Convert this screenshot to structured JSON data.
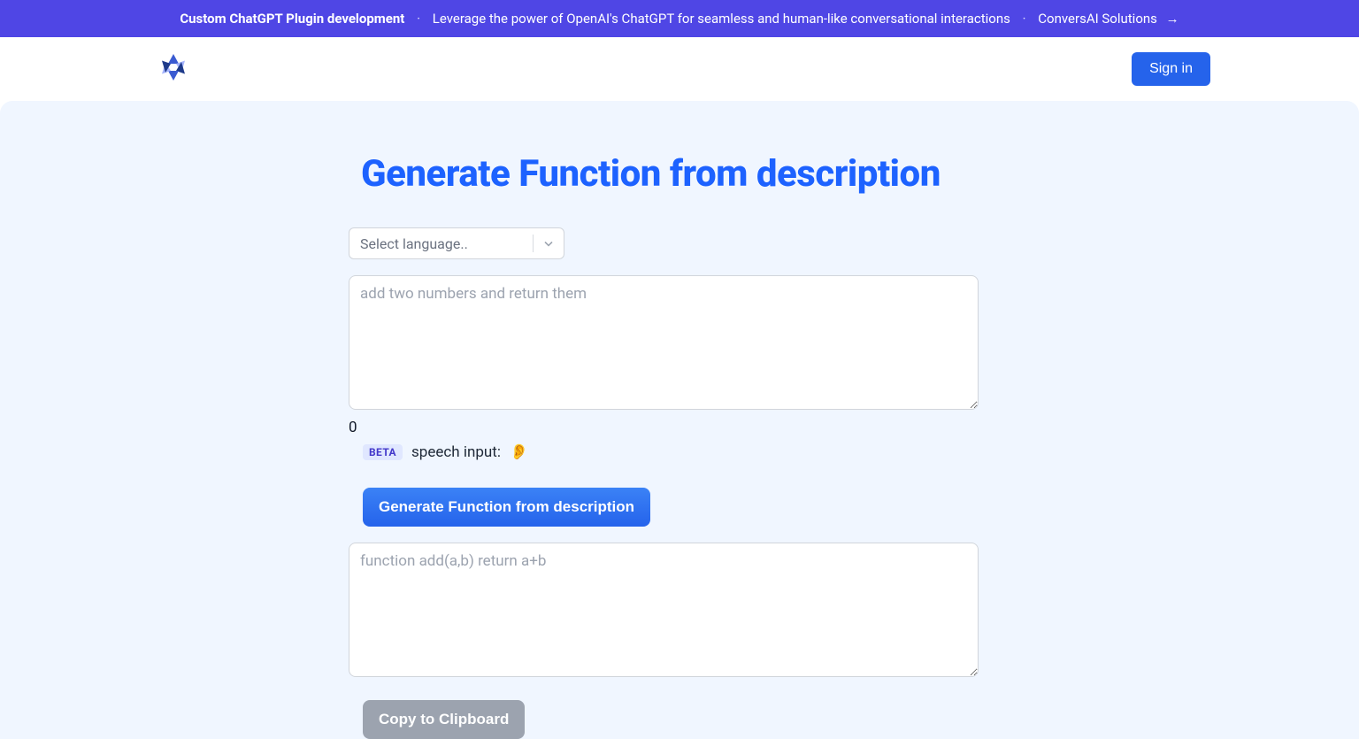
{
  "banner": {
    "headline": "Custom ChatGPT Plugin development",
    "subline": "Leverage the power of OpenAI's ChatGPT for seamless and human-like conversational interactions",
    "cta_label": "ConversAI Solutions",
    "arrow": "→",
    "separator": "·"
  },
  "header": {
    "signin_label": "Sign in"
  },
  "main": {
    "title": "Generate Function from description",
    "language_placeholder": "Select language..",
    "description_placeholder": "add two numbers and return them",
    "char_count": "0",
    "beta_label": "BETA",
    "speech_label": "speech input:",
    "ear_emoji": "👂",
    "generate_button": "Generate Function from description",
    "output_placeholder": "function add(a,b) return a+b",
    "copy_button": "Copy to Clipboard"
  }
}
